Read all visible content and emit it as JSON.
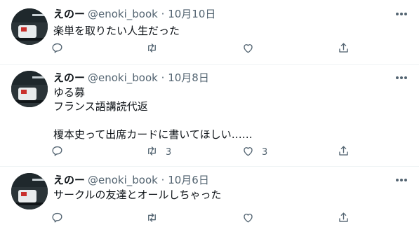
{
  "colors": {
    "text": "#0f1419",
    "muted": "#536471",
    "divider": "#eff3f4"
  },
  "tweets": [
    {
      "name": "えのー",
      "handle": "@enoki_book",
      "dot": "·",
      "date": "10月10日",
      "text": "楽単を取りたい人生だった",
      "reply_count": "",
      "retweet_count": "",
      "like_count": ""
    },
    {
      "name": "えのー",
      "handle": "@enoki_book",
      "dot": "·",
      "date": "10月8日",
      "text": "ゆる募\nフランス語講読代返\n\n榎本史って出席カードに書いてほしい……",
      "reply_count": "",
      "retweet_count": "3",
      "like_count": "3"
    },
    {
      "name": "えのー",
      "handle": "@enoki_book",
      "dot": "·",
      "date": "10月6日",
      "text": "サークルの友達とオールしちゃった",
      "reply_count": "",
      "retweet_count": "",
      "like_count": ""
    }
  ],
  "icons": [
    "more-icon",
    "reply-icon",
    "retweet-icon",
    "like-icon",
    "share-icon"
  ]
}
